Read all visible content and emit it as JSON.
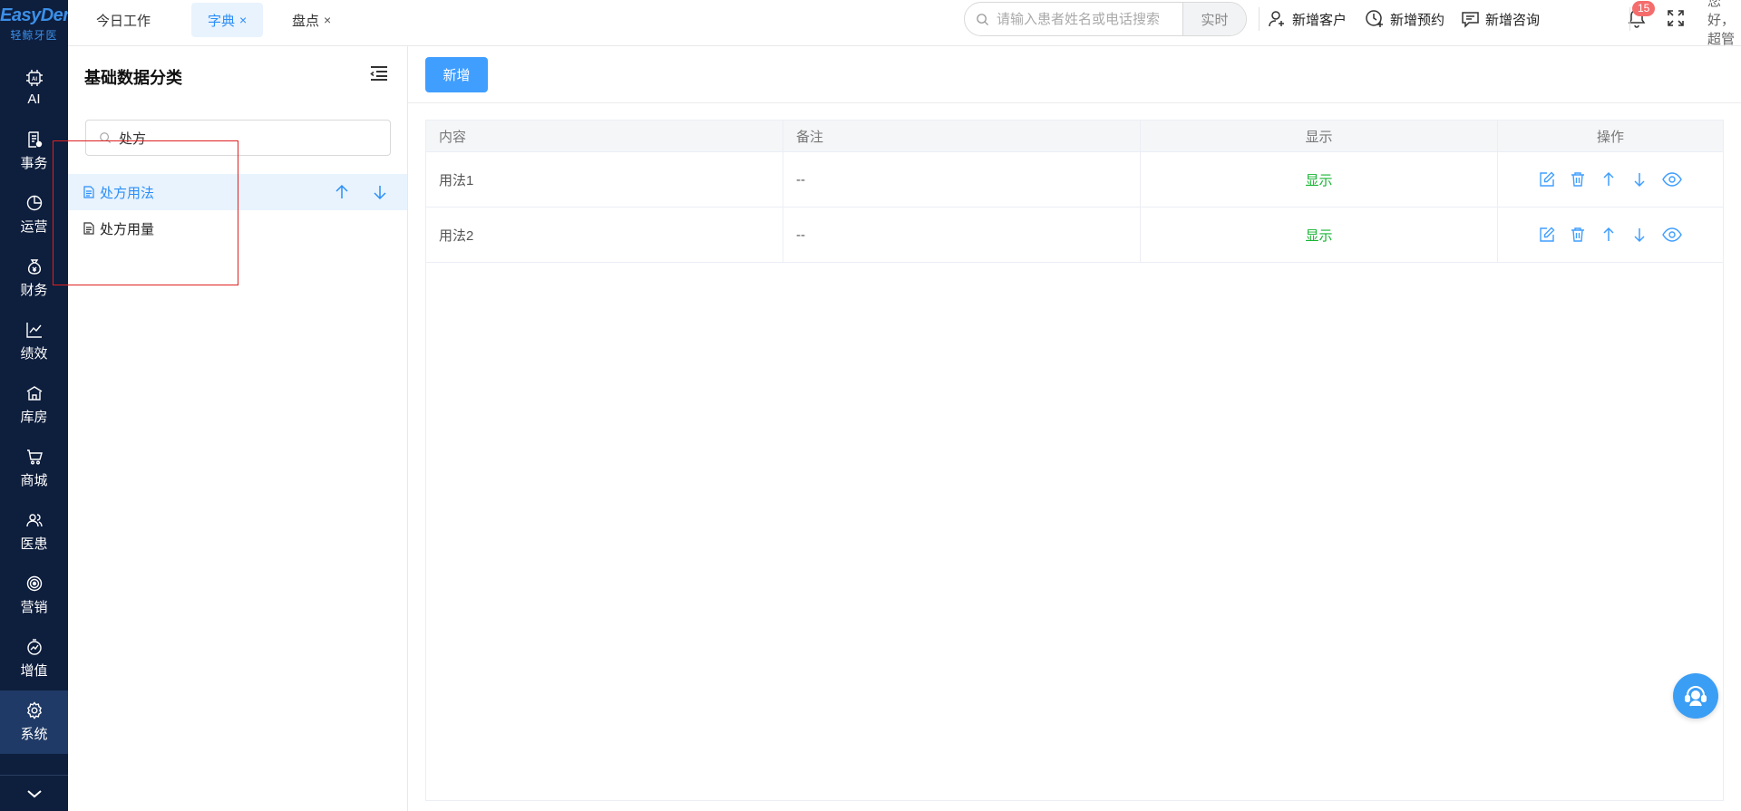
{
  "logo": {
    "brand": "EasyDent",
    "sub": "轻鲸牙医"
  },
  "nav": [
    {
      "icon": "ai-chip-icon",
      "label": "AI"
    },
    {
      "icon": "task-doc-icon",
      "label": "事务"
    },
    {
      "icon": "pie-chart-icon",
      "label": "运营"
    },
    {
      "icon": "money-bag-icon",
      "label": "财务"
    },
    {
      "icon": "trend-line-icon",
      "label": "绩效"
    },
    {
      "icon": "warehouse-icon",
      "label": "库房"
    },
    {
      "icon": "cart-icon",
      "label": "商城"
    },
    {
      "icon": "users-icon",
      "label": "医患"
    },
    {
      "icon": "target-icon",
      "label": "营销"
    },
    {
      "icon": "growth-icon",
      "label": "增值"
    },
    {
      "icon": "gear-icon",
      "label": "系统"
    }
  ],
  "tabs": [
    {
      "label": "今日工作",
      "closable": false
    },
    {
      "label": "字典",
      "closable": true
    },
    {
      "label": "盘点",
      "closable": true
    }
  ],
  "close_glyph": "×",
  "search": {
    "placeholder": "请输入患者姓名或电话搜索",
    "realtime": "实时"
  },
  "actions": {
    "new_customer": "新增客户",
    "new_appointment": "新增预约",
    "new_consult": "新增咨询"
  },
  "notifications": {
    "count": "15"
  },
  "greeting": "您好，超管",
  "category": {
    "title": "基础数据分类",
    "search_value": "处方",
    "items": [
      {
        "label": "处方用法",
        "active": true
      },
      {
        "label": "处方用量",
        "active": false
      }
    ]
  },
  "main": {
    "add_label": "新增",
    "columns": [
      "内容",
      "备注",
      "显示",
      "操作"
    ],
    "rows": [
      {
        "content": "用法1",
        "note": "--",
        "display": "显示"
      },
      {
        "content": "用法2",
        "note": "--",
        "display": "显示"
      }
    ]
  },
  "colors": {
    "nav_bg": "#0e1e3d",
    "accent": "#409eff",
    "show_green": "#18b534",
    "badge_red": "#f56c6c"
  }
}
